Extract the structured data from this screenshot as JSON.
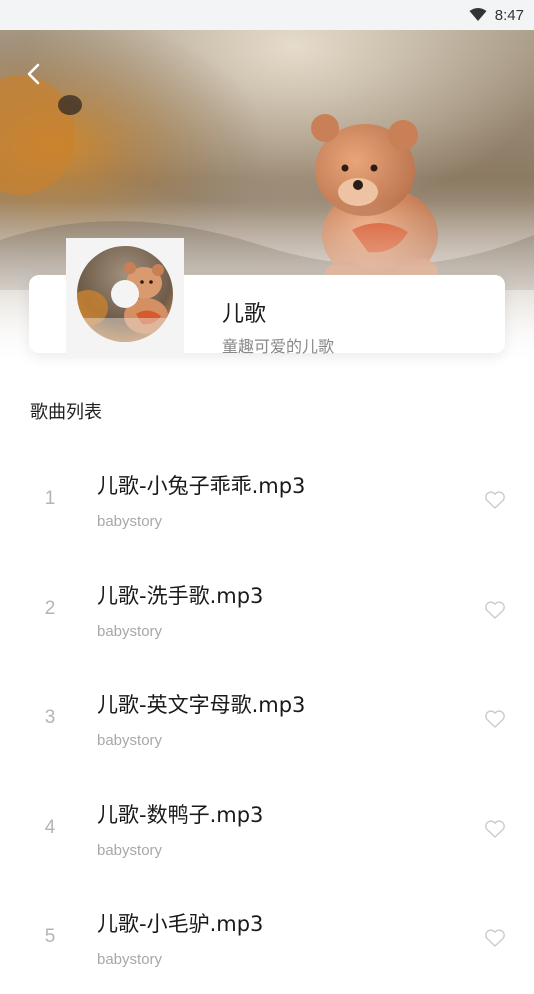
{
  "status_bar": {
    "time": "8:47",
    "wifi_icon": "wifi-icon"
  },
  "header": {
    "back_icon": "chevron-left-icon",
    "background": "teddy-bear-photo"
  },
  "album": {
    "title": "儿歌",
    "subtitle": "童趣可爱的儿歌",
    "cover": "teddy-bear-disc-cover"
  },
  "section": {
    "title": "歌曲列表"
  },
  "songs": [
    {
      "index": "1",
      "title": "儿歌-小兔子乖乖.mp3",
      "artist": "babystory"
    },
    {
      "index": "2",
      "title": "儿歌-洗手歌.mp3",
      "artist": "babystory"
    },
    {
      "index": "3",
      "title": "儿歌-英文字母歌.mp3",
      "artist": "babystory"
    },
    {
      "index": "4",
      "title": "儿歌-数鸭子.mp3",
      "artist": "babystory"
    },
    {
      "index": "5",
      "title": "儿歌-小毛驴.mp3",
      "artist": "babystory"
    }
  ],
  "colors": {
    "heart_outline": "#cccccc",
    "index_text": "#b4b4b4",
    "artist_text": "#a8a8a8"
  }
}
